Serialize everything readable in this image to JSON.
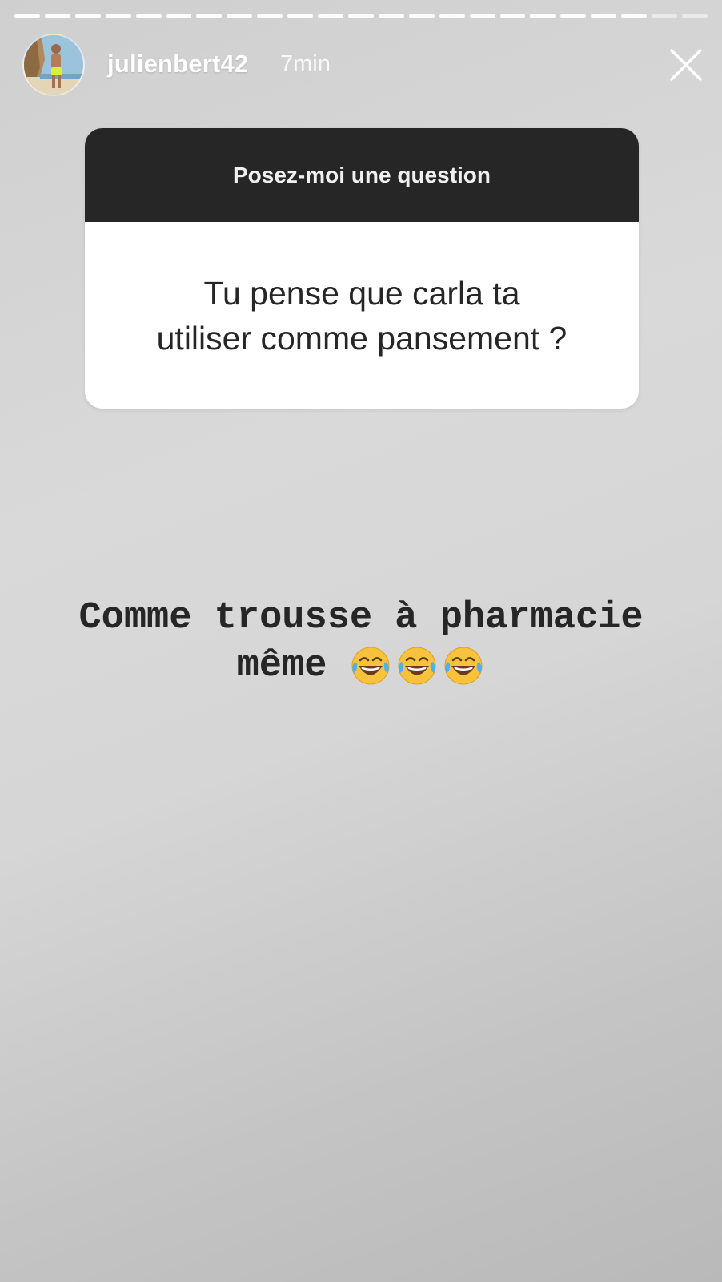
{
  "story": {
    "segments_total": 23,
    "segments_viewed": 21,
    "username": "julienbert42",
    "timestamp": "7min",
    "avatar_icon": "profile-avatar",
    "close_icon": "close-icon"
  },
  "question_sticker": {
    "header": "Posez-moi une question",
    "question": "Tu pense que carla ta\nutiliser comme pansement ?"
  },
  "caption": {
    "line1": "Comme trousse à pharmacie",
    "line2": "même",
    "emoji": "face-with-tears-of-joy",
    "emoji_count": 3
  },
  "colors": {
    "sticker_header_bg": "#262626",
    "sticker_body_bg": "#ffffff",
    "text_dark": "#262626",
    "emoji_yellow": "#f7c23c"
  }
}
